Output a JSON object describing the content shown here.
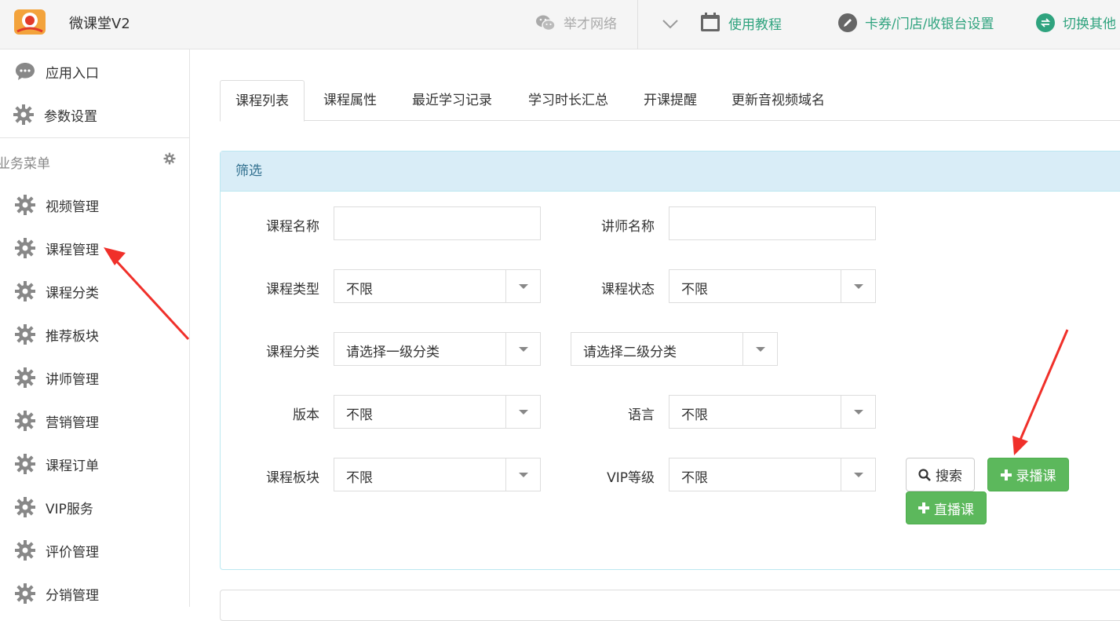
{
  "header": {
    "app_title": "微课堂V2",
    "wechat_label": "举才网络",
    "tutorial_label": "使用教程",
    "coupon_label": "卡券/门店/收银台设置",
    "switch_label": "切换其他",
    "accent_color": "#2fa37e"
  },
  "sidebar": {
    "top_items": [
      {
        "label": "应用入口",
        "icon": "chat-bubble-icon"
      },
      {
        "label": "参数设置",
        "icon": "gear-icon"
      }
    ],
    "section_label": "业务菜单",
    "items": [
      {
        "label": "视频管理"
      },
      {
        "label": "课程管理"
      },
      {
        "label": "课程分类"
      },
      {
        "label": "推荐板块"
      },
      {
        "label": "讲师管理"
      },
      {
        "label": "营销管理"
      },
      {
        "label": "课程订单"
      },
      {
        "label": "VIP服务"
      },
      {
        "label": "评价管理"
      },
      {
        "label": "分销管理"
      }
    ]
  },
  "tabs": [
    {
      "label": "课程列表",
      "active": true
    },
    {
      "label": "课程属性"
    },
    {
      "label": "最近学习记录"
    },
    {
      "label": "学习时长汇总"
    },
    {
      "label": "开课提醒"
    },
    {
      "label": "更新音视频域名"
    }
  ],
  "filter": {
    "title": "筛选",
    "course_name_label": "课程名称",
    "course_name_value": "",
    "teacher_name_label": "讲师名称",
    "teacher_name_value": "",
    "course_type_label": "课程类型",
    "course_type_value": "不限",
    "course_status_label": "课程状态",
    "course_status_value": "不限",
    "category_label": "课程分类",
    "category1_value": "请选择一级分类",
    "category2_value": "请选择二级分类",
    "version_label": "版本",
    "version_value": "不限",
    "language_label": "语言",
    "language_value": "不限",
    "block_label": "课程板块",
    "block_value": "不限",
    "vip_label": "VIP等级",
    "vip_value": "不限",
    "search_button": "搜索",
    "record_button": "录播课",
    "live_button": "直播课"
  }
}
